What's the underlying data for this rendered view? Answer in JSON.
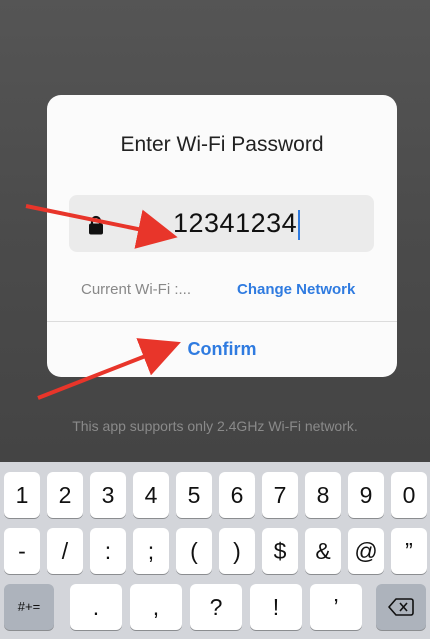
{
  "background": {
    "hint": "This app supports only 2.4GHz Wi-Fi network."
  },
  "dialog": {
    "title": "Enter Wi-Fi Password",
    "password_value": "12341234",
    "current_wifi_label": "Current Wi-Fi :...",
    "change_network_label": "Change Network",
    "confirm_label": "Confirm",
    "lock_icon": "lock-icon",
    "accent_color": "#2f7be0"
  },
  "keyboard": {
    "row1": [
      "1",
      "2",
      "3",
      "4",
      "5",
      "6",
      "7",
      "8",
      "9",
      "0"
    ],
    "row2": [
      "-",
      "/",
      ":",
      ";",
      "(",
      ")",
      "$",
      "&",
      "@",
      "”"
    ],
    "row3_left": "#+=",
    "row3": [
      ".",
      ",",
      "?",
      "!",
      "’"
    ],
    "backspace_icon": "backspace-icon"
  },
  "annotations": {
    "arrow_color": "#e8352a"
  }
}
